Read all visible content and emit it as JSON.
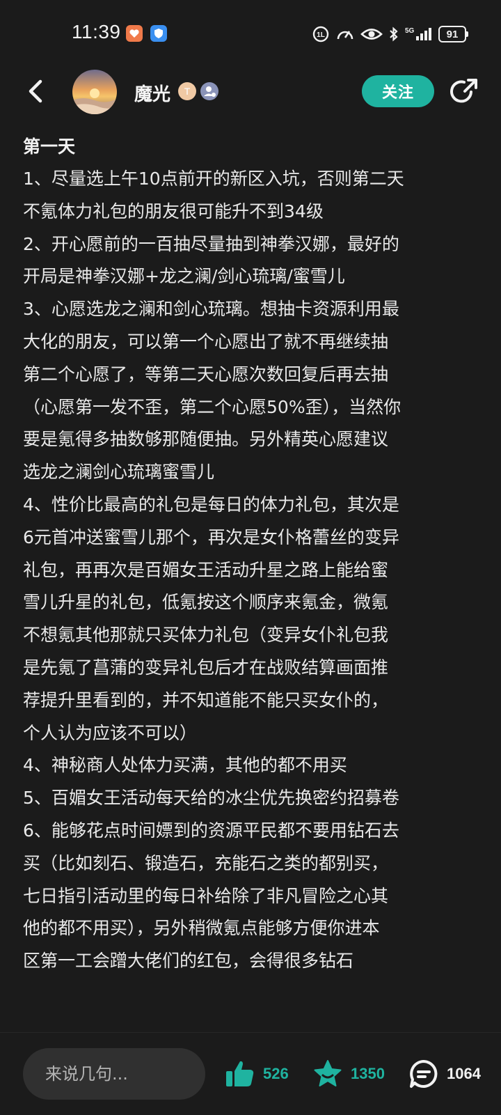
{
  "status_bar": {
    "time": "11:39",
    "battery": "91"
  },
  "header": {
    "username": "魔光",
    "level_badge": "T",
    "follow_label": "关注"
  },
  "article": {
    "heading": "第一天",
    "lines": [
      "1、尽量选上午10点前开的新区入坑，否则第二天",
      "不氪体力礼包的朋友很可能升不到34级",
      "2、开心愿前的一百抽尽量抽到神拳汉娜，最好的",
      "开局是神拳汉娜+龙之澜/剑心琉璃/蜜雪儿",
      "3、心愿选龙之澜和剑心琉璃。想抽卡资源利用最",
      "大化的朋友，可以第一个心愿出了就不再继续抽",
      "第二个心愿了，等第二天心愿次数回复后再去抽",
      "（心愿第一发不歪，第二个心愿50%歪），当然你",
      "要是氪得多抽数够那随便抽。另外精英心愿建议",
      "选龙之澜剑心琉璃蜜雪儿",
      "4、性价比最高的礼包是每日的体力礼包，其次是",
      "6元首冲送蜜雪儿那个，再次是女仆格蕾丝的变异",
      "礼包，再再次是百媚女王活动升星之路上能给蜜",
      "雪儿升星的礼包，低氪按这个顺序来氪金，微氪",
      "不想氪其他那就只买体力礼包（变异女仆礼包我",
      "是先氪了菖蒲的变异礼包后才在战败结算画面推",
      "荐提升里看到的，并不知道能不能只买女仆的，",
      "个人认为应该不可以）",
      "4、神秘商人处体力买满，其他的都不用买",
      "5、百媚女王活动每天给的冰尘优先换密约招募卷",
      "6、能够花点时间嫖到的资源平民都不要用钻石去",
      "买（比如刻石、锻造石，充能石之类的都别买，",
      "七日指引活动里的每日补给除了非凡冒险之心其",
      "他的都不用买），另外稍微氪点能够方便你进本",
      "区第一工会蹭大佬们的红包，会得很多钻石"
    ]
  },
  "bottom_bar": {
    "comment_placeholder": "来说几句...",
    "like_count": "526",
    "favorite_count": "1350",
    "comment_count": "1064",
    "accent_color": "#1fb3a0"
  }
}
